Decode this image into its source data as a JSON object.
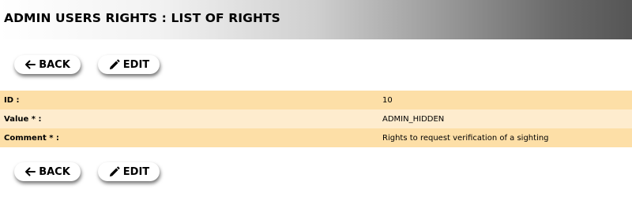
{
  "header": {
    "title": "ADMIN USERS RIGHTS : LIST OF RIGHTS"
  },
  "toolbar_top": {
    "back_label": "BACK",
    "edit_label": "EDIT"
  },
  "details": {
    "rows": [
      {
        "label": "ID :",
        "value": "10"
      },
      {
        "label": "Value * :",
        "value": "ADMIN_HIDDEN"
      },
      {
        "label": "Comment * :",
        "value": "Rights to request verification of a sighting"
      }
    ]
  },
  "toolbar_bottom": {
    "back_label": "BACK",
    "edit_label": "EDIT"
  },
  "icons": {
    "back": "arrow-left-icon",
    "edit": "pencil-icon"
  }
}
